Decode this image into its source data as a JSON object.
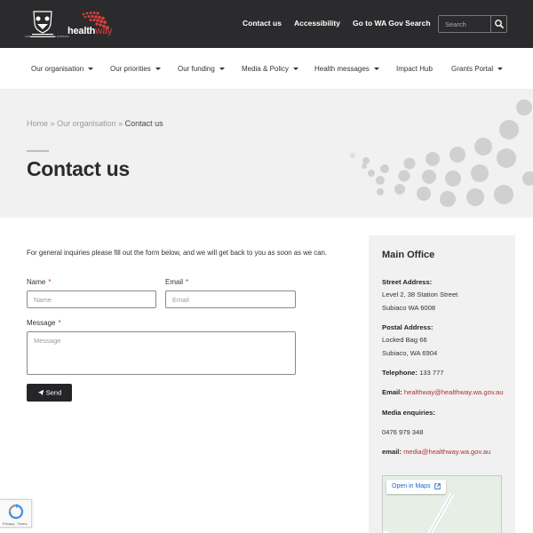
{
  "header": {
    "brand_text_a": "health",
    "brand_text_b": "way",
    "crest_text": "GOVERNMENT OF WESTERN AUSTRALIA",
    "links": [
      "Contact us",
      "Accessibility",
      "Go to WA Gov Search"
    ],
    "search_placeholder": "Search"
  },
  "nav": {
    "items": [
      {
        "label": "Our organisation"
      },
      {
        "label": "Our priorities"
      },
      {
        "label": "Our funding"
      },
      {
        "label": "Media & Policy"
      },
      {
        "label": "Health messages"
      },
      {
        "label": "Impact Hub"
      },
      {
        "label": "Grants Portal"
      }
    ]
  },
  "hero": {
    "breadcrumb_home": "Home",
    "breadcrumb_sep": "»",
    "breadcrumb_section": "Our organisation",
    "breadcrumb_current": "Contact us",
    "title": "Contact us"
  },
  "form": {
    "intro": "For general inquiries please fill out the form below, and we will get back to you as soon as we can.",
    "name_label": "Name",
    "name_placeholder": "Name",
    "email_label": "Email",
    "email_placeholder": "Email",
    "message_label": "Message",
    "message_placeholder": "Message",
    "required_mark": "*",
    "send_label": "Send"
  },
  "office": {
    "title": "Main Office",
    "street_label": "Street Address:",
    "street_line1": "Level 2, 38 Station Street",
    "street_line2": "Subiaco WA 6008",
    "postal_label": "Postal Address:",
    "postal_line1": "Locked Bag 66",
    "postal_line2": "Subiaco, WA 6904",
    "telephone_label": "Telephone:",
    "telephone": "133 777",
    "email_label": "Email:",
    "email": "healthway@healthway.wa.gov.au",
    "media_label": "Media enquiries:",
    "media_phone": "0476 979 348",
    "media_email_label": "email:",
    "media_email": "media@healthway.wa.gov.au",
    "open_maps": "Open in Maps"
  },
  "recaptcha": {
    "links": "Privacy - Terms"
  },
  "colors": {
    "topbar": "#2b2b2d",
    "accent_red": "#e23b3b",
    "link_red": "#b03030",
    "hero_bg": "#f1f1f1"
  }
}
